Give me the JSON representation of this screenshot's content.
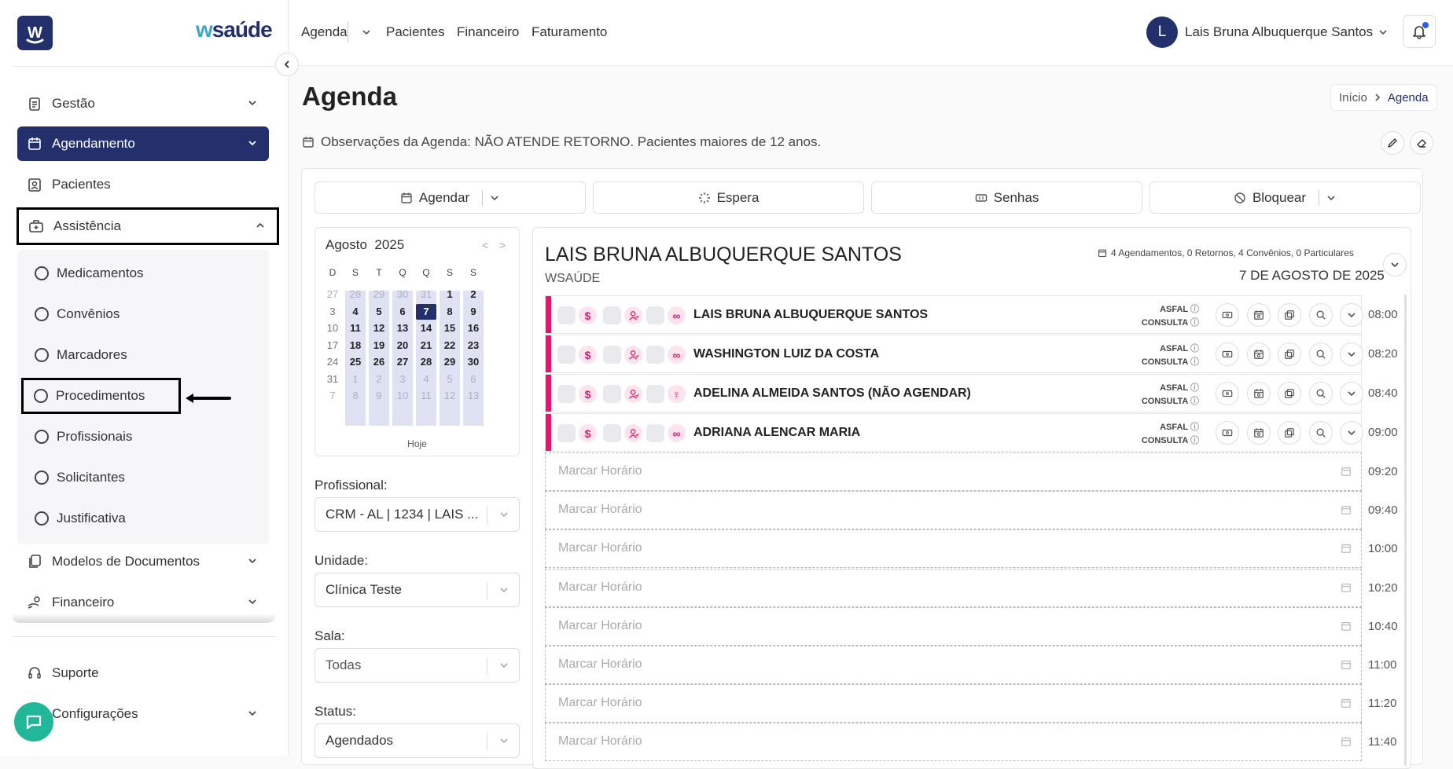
{
  "brand": {
    "logo_letter": "W",
    "name_prefix": "w",
    "name_suffix": "saúde"
  },
  "sidebar": {
    "items": [
      {
        "label": "Gestão",
        "icon": "clipboard-icon"
      },
      {
        "label": "Agendamento",
        "icon": "calendar-icon"
      },
      {
        "label": "Pacientes",
        "icon": "patient-icon"
      },
      {
        "label": "Assistência",
        "icon": "medical-bag-icon"
      }
    ],
    "subitems": [
      "Medicamentos",
      "Convênios",
      "Marcadores",
      "Procedimentos",
      "Profissionais",
      "Solicitantes",
      "Justificativa"
    ],
    "items_after": [
      {
        "label": "Modelos de Documentos",
        "icon": "documents-icon"
      },
      {
        "label": "Financeiro",
        "icon": "money-hand-icon"
      }
    ],
    "footer": [
      {
        "label": "Suporte",
        "icon": "headset-icon"
      },
      {
        "label": "Configurações",
        "icon": "gear-icon"
      }
    ]
  },
  "topnav": {
    "items": [
      "Agenda",
      "Pacientes",
      "Financeiro",
      "Faturamento"
    ],
    "user_initial": "L",
    "user_name": "Lais Bruna Albuquerque Santos"
  },
  "page": {
    "title": "Agenda",
    "breadcrumb": [
      "Início",
      "Agenda"
    ],
    "observations": "Observações da Agenda: NÃO ATENDE RETORNO. Pacientes maiores de 12 anos."
  },
  "actions": [
    "Agendar",
    "Espera",
    "Senhas",
    "Bloquear"
  ],
  "calendar": {
    "month": "Agosto",
    "year": "2025",
    "dow": [
      "D",
      "S",
      "T",
      "Q",
      "Q",
      "S",
      "S"
    ],
    "weeks": [
      [
        "27",
        "28",
        "29",
        "30",
        "31",
        "1",
        "2"
      ],
      [
        "3",
        "4",
        "5",
        "6",
        "7",
        "8",
        "9"
      ],
      [
        "10",
        "11",
        "12",
        "13",
        "14",
        "15",
        "16"
      ],
      [
        "17",
        "18",
        "19",
        "20",
        "21",
        "22",
        "23"
      ],
      [
        "24",
        "25",
        "26",
        "27",
        "28",
        "29",
        "30"
      ],
      [
        "31",
        "1",
        "2",
        "3",
        "4",
        "5",
        "6"
      ],
      [
        "7",
        "8",
        "9",
        "10",
        "11",
        "12",
        "13"
      ]
    ],
    "selected": "7",
    "today_label": "Hoje"
  },
  "filters": [
    {
      "label": "Profissional:",
      "value": "CRM - AL | 1234 | LAIS ..."
    },
    {
      "label": "Unidade:",
      "value": "Clínica Teste"
    },
    {
      "label": "Sala:",
      "value": "Todas"
    },
    {
      "label": "Status:",
      "value": "Agendados"
    }
  ],
  "agenda": {
    "professional": "LAIS BRUNA ALBUQUERQUE SANTOS",
    "unit": "WSAÚDE",
    "stats": "4 Agendamentos, 0 Retornos, 4 Convênios, 0 Particulares",
    "date": "7 DE AGOSTO DE 2025",
    "appointments": [
      {
        "name": "LAIS BRUNA ALBUQUERQUE SANTOS",
        "plan": "ASFAL",
        "type": "CONSULTA",
        "time": "08:00",
        "icon": "glasses-icon",
        "glyph": "∞"
      },
      {
        "name": "WASHINGTON LUIZ DA COSTA",
        "plan": "ASFAL",
        "type": "CONSULTA",
        "time": "08:20",
        "icon": "infinity-icon",
        "glyph": "∞"
      },
      {
        "name": "ADELINA ALMEIDA SANTOS (NÃO AGENDAR)",
        "plan": "ASFAL",
        "type": "CONSULTA",
        "time": "08:40",
        "icon": "female-icon",
        "glyph": "♀"
      },
      {
        "name": "ADRIANA ALENCAR MARIA",
        "plan": "ASFAL",
        "type": "CONSULTA",
        "time": "09:00",
        "icon": "glasses-icon",
        "glyph": "∞"
      }
    ],
    "slot_placeholder": "Marcar Horário",
    "slots": [
      "09:20",
      "09:40",
      "10:00",
      "10:20",
      "10:40",
      "11:00",
      "11:20",
      "11:40"
    ]
  },
  "colors": {
    "primary": "#24306b",
    "accent": "#d81b6e",
    "chat": "#23b79a"
  }
}
